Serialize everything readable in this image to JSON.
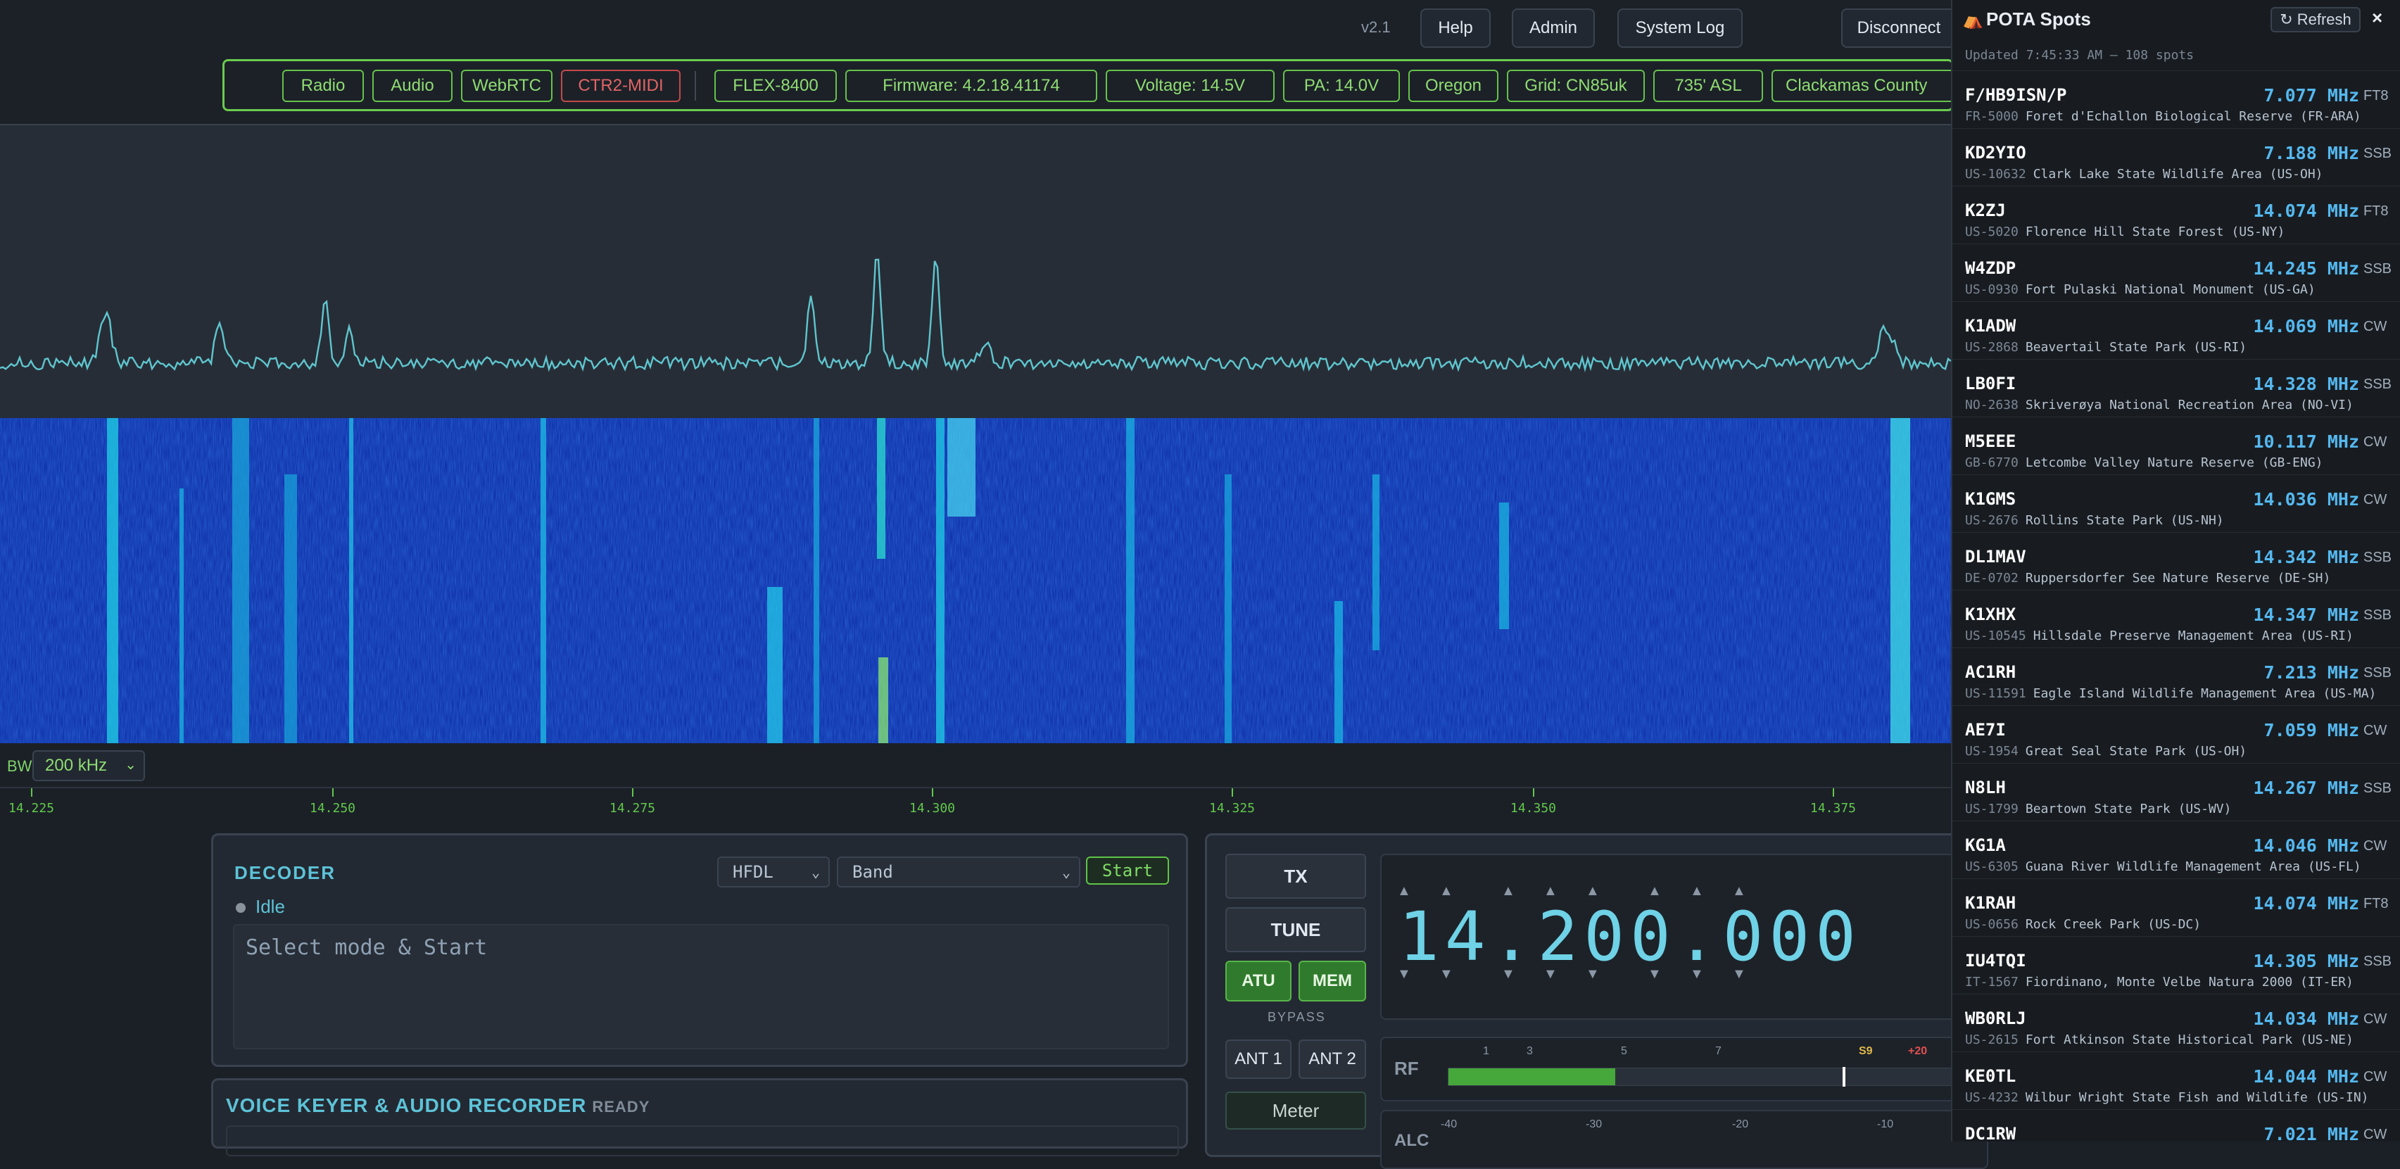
{
  "header": {
    "version": "v2.1",
    "buttons": {
      "help": "Help",
      "admin": "Admin",
      "system_log": "System Log",
      "disconnect": "Disconnect"
    }
  },
  "status_chips": [
    {
      "label": "Radio",
      "state": "ok"
    },
    {
      "label": "Audio",
      "state": "ok"
    },
    {
      "label": "WebRTC",
      "state": "ok"
    },
    {
      "label": "CTR2-MIDI",
      "state": "error"
    },
    {
      "label": "FLEX-8400",
      "state": "ok"
    },
    {
      "label": "Firmware: 4.2.18.41174",
      "state": "ok"
    },
    {
      "label": "Voltage: 14.5V",
      "state": "ok"
    },
    {
      "label": "PA: 14.0V",
      "state": "ok"
    },
    {
      "label": "Oregon",
      "state": "ok"
    },
    {
      "label": "Grid: CN85uk",
      "state": "ok"
    },
    {
      "label": "735' ASL",
      "state": "ok"
    },
    {
      "label": "Clackamas County",
      "state": "ok"
    }
  ],
  "panadapter": {
    "bw_label": "BW",
    "bw_value": "200 kHz",
    "axis_ticks": [
      "14.225",
      "14.250",
      "14.275",
      "14.300",
      "14.325",
      "14.350",
      "14.375"
    ]
  },
  "decoder": {
    "title": "DECODER",
    "mode": "HFDL",
    "band": "Band",
    "start": "Start",
    "status": "Idle",
    "output": "Select mode & Start"
  },
  "voice_keyer": {
    "title": "VOICE KEYER & AUDIO RECORDER",
    "status": "READY"
  },
  "radio": {
    "tx": "TX",
    "tune": "TUNE",
    "atu": "ATU",
    "mem": "MEM",
    "bypass": "BYPASS",
    "ant1": "ANT 1",
    "ant2": "ANT 2",
    "meter": "Meter",
    "frequency": "14.200.000",
    "rf_label": "RF",
    "rf_scale": [
      "1",
      "3",
      "5",
      "7",
      "S9",
      "+20"
    ],
    "rf_level_pct": 32,
    "alc_label": "ALC",
    "alc_scale": [
      "-40",
      "-30",
      "-20",
      "-10"
    ]
  },
  "pota": {
    "title": "POTA Spots",
    "refresh": "↻ Refresh",
    "close": "×",
    "updated": "Updated 7:45:33 AM — 108 spots",
    "spots": [
      {
        "call": "F/HB9ISN/P",
        "freq": "7.077 MHz",
        "mode": "FT8",
        "ref": "FR-5000",
        "park": "Foret d'Echallon Biological Reserve (FR-ARA)"
      },
      {
        "call": "KD2YIO",
        "freq": "7.188 MHz",
        "mode": "SSB",
        "ref": "US-10632",
        "park": "Clark Lake State Wildlife Area (US-OH)"
      },
      {
        "call": "K2ZJ",
        "freq": "14.074 MHz",
        "mode": "FT8",
        "ref": "US-5020",
        "park": "Florence Hill State Forest (US-NY)"
      },
      {
        "call": "W4ZDP",
        "freq": "14.245 MHz",
        "mode": "SSB",
        "ref": "US-0930",
        "park": "Fort Pulaski National Monument (US-GA)"
      },
      {
        "call": "K1ADW",
        "freq": "14.069 MHz",
        "mode": "CW",
        "ref": "US-2868",
        "park": "Beavertail State Park (US-RI)"
      },
      {
        "call": "LB0FI",
        "freq": "14.328 MHz",
        "mode": "SSB",
        "ref": "NO-2638",
        "park": "Skriverøya National Recreation Area (NO-VI)"
      },
      {
        "call": "M5EEE",
        "freq": "10.117 MHz",
        "mode": "CW",
        "ref": "GB-6770",
        "park": "Letcombe Valley Nature Reserve (GB-ENG)"
      },
      {
        "call": "K1GMS",
        "freq": "14.036 MHz",
        "mode": "CW",
        "ref": "US-2676",
        "park": "Rollins State Park (US-NH)"
      },
      {
        "call": "DL1MAV",
        "freq": "14.342 MHz",
        "mode": "SSB",
        "ref": "DE-0702",
        "park": "Ruppersdorfer See Nature Reserve (DE-SH)"
      },
      {
        "call": "K1XHX",
        "freq": "14.347 MHz",
        "mode": "SSB",
        "ref": "US-10545",
        "park": "Hillsdale Preserve Management Area (US-RI)"
      },
      {
        "call": "AC1RH",
        "freq": "7.213 MHz",
        "mode": "SSB",
        "ref": "US-11591",
        "park": "Eagle Island Wildlife Management Area (US-MA)"
      },
      {
        "call": "AE7I",
        "freq": "7.059 MHz",
        "mode": "CW",
        "ref": "US-1954",
        "park": "Great Seal State Park (US-OH)"
      },
      {
        "call": "N8LH",
        "freq": "14.267 MHz",
        "mode": "SSB",
        "ref": "US-1799",
        "park": "Beartown State Park (US-WV)"
      },
      {
        "call": "KG1A",
        "freq": "14.046 MHz",
        "mode": "CW",
        "ref": "US-6305",
        "park": "Guana River Wildlife Management Area (US-FL)"
      },
      {
        "call": "K1RAH",
        "freq": "14.074 MHz",
        "mode": "FT8",
        "ref": "US-0656",
        "park": "Rock Creek Park (US-DC)"
      },
      {
        "call": "IU4TQI",
        "freq": "14.305 MHz",
        "mode": "SSB",
        "ref": "IT-1567",
        "park": "Fiordinano, Monte Velbe Natura 2000 (IT-ER)"
      },
      {
        "call": "WB0RLJ",
        "freq": "14.034 MHz",
        "mode": "CW",
        "ref": "US-2615",
        "park": "Fort Atkinson State Historical Park (US-NE)"
      },
      {
        "call": "KE0TL",
        "freq": "14.044 MHz",
        "mode": "CW",
        "ref": "US-4232",
        "park": "Wilbur Wright State Fish and Wildlife (US-IN)"
      },
      {
        "call": "DC1RW",
        "freq": "7.021 MHz",
        "mode": "CW",
        "ref": "",
        "park": ""
      }
    ]
  }
}
